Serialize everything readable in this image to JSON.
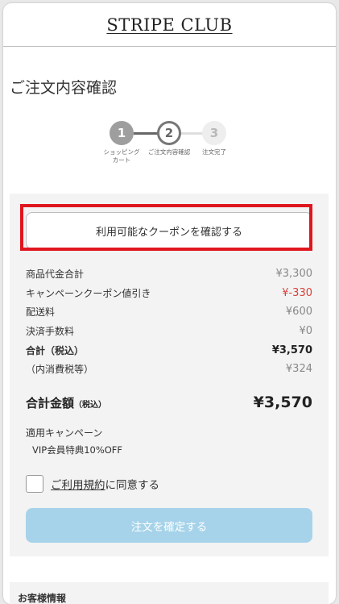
{
  "header": {
    "logo": "STRIPE CLUB"
  },
  "page": {
    "title": "ご注文内容確認"
  },
  "stepper": {
    "steps": [
      {
        "number": "1",
        "label_line1": "ショッピング",
        "label_line2": "カート"
      },
      {
        "number": "2",
        "label_line1": "ご注文内容確認",
        "label_line2": ""
      },
      {
        "number": "3",
        "label_line1": "注文完了",
        "label_line2": ""
      }
    ]
  },
  "coupon": {
    "button_label": "利用可能なクーポンを確認する"
  },
  "summary": {
    "rows": [
      {
        "label": "商品代金合計",
        "value": "¥3,300"
      },
      {
        "label": "キャンペーンクーポン値引き",
        "value": "¥-330"
      },
      {
        "label": "配送料",
        "value": "¥600"
      },
      {
        "label": "決済手数料",
        "value": "¥0"
      },
      {
        "label": "合計（税込）",
        "value": "¥3,570"
      },
      {
        "label": "（内消費税等）",
        "value": "¥324"
      }
    ],
    "grand_total": {
      "label": "合計金額",
      "label_suffix": "（税込）",
      "value": "¥3,570"
    },
    "campaign": {
      "heading": "適用キャンペーン",
      "item": "VIP会員特典10%OFF"
    }
  },
  "agreement": {
    "link_text": "ご利用規約",
    "rest_text": "に同意する"
  },
  "confirm": {
    "button_label": "注文を確定する"
  },
  "next_section": {
    "heading": "お客様情報"
  },
  "colors": {
    "highlight_border": "#e0161e",
    "discount_text": "#d9403b",
    "confirm_button_disabled": "#a6d3ea"
  }
}
